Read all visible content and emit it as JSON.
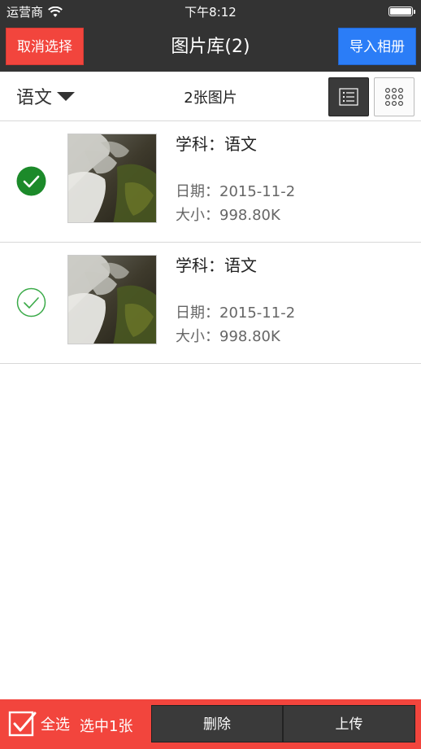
{
  "status_bar": {
    "carrier": "运营商",
    "time": "下午8:12",
    "wifi_icon": "wifi-icon",
    "battery_icon": "battery-icon"
  },
  "nav": {
    "cancel_selection": "取消选择",
    "title": "图片库(2)",
    "import_album": "导入相册",
    "colors": {
      "bar": "#333333",
      "cancel": "#f2453d",
      "import": "#2b7df7"
    }
  },
  "toolbar": {
    "subject": "语文",
    "count": "2张图片",
    "list_view_icon": "list-view-icon",
    "grid_view_icon": "grid-view-icon",
    "active_view": "list"
  },
  "items": [
    {
      "subject": "学科：语文",
      "date": "日期：2015-11-2",
      "size": "大小：998.80K",
      "selected": true
    },
    {
      "subject": "学科：语文",
      "date": "日期：2015-11-2",
      "size": "大小：998.80K",
      "selected": false
    }
  ],
  "bottom": {
    "select_all": "全选",
    "selected_count": "选中1张",
    "delete": "删除",
    "upload": "上传",
    "colors": {
      "bar": "#f2453d",
      "check_selected": "#1c8a2a",
      "check_unselected": "#3aaa48"
    }
  }
}
